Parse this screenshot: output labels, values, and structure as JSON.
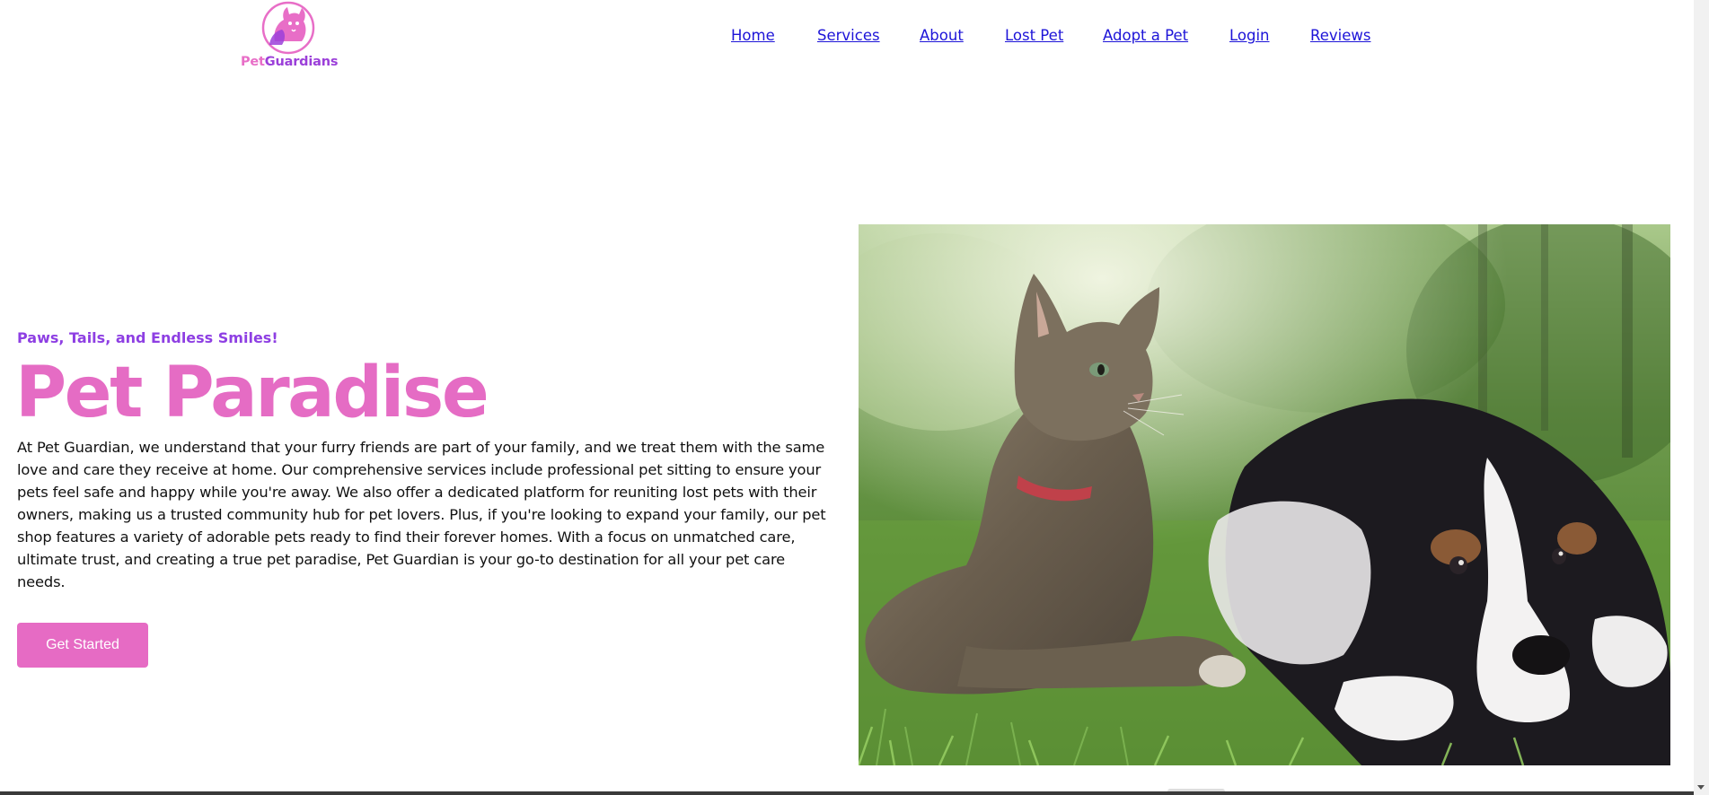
{
  "brand": {
    "name_part1": "Pet",
    "name_part2": "Guardians"
  },
  "nav": {
    "items": [
      "Home",
      "Services",
      "About",
      "Lost Pet",
      "Adopt a Pet",
      "Login",
      "Reviews"
    ]
  },
  "hero": {
    "tagline": "Paws, Tails, and Endless Smiles!",
    "title": "Pet Paradise",
    "description": "At Pet Guardian, we understand that your furry friends are part of your family, and we treat them with the same love and care they receive at home. Our comprehensive services include professional pet sitting to ensure your pets feel safe and happy while you're away. We also offer a dedicated platform for reuniting lost pets with their owners, making us a trusted community hub for pet lovers. Plus, if you're looking to expand your family, our pet shop features a variety of adorable pets ready to find their forever homes. With a focus on unmatched care, ultimate trust, and creating a true pet paradise, Pet Guardian is your go-to destination for all your pet care needs.",
    "cta_label": "Get Started"
  },
  "colors": {
    "accent_pink": "#e66bc4",
    "accent_purple": "#8e3fe3",
    "link_blue": "#1d14d8"
  }
}
